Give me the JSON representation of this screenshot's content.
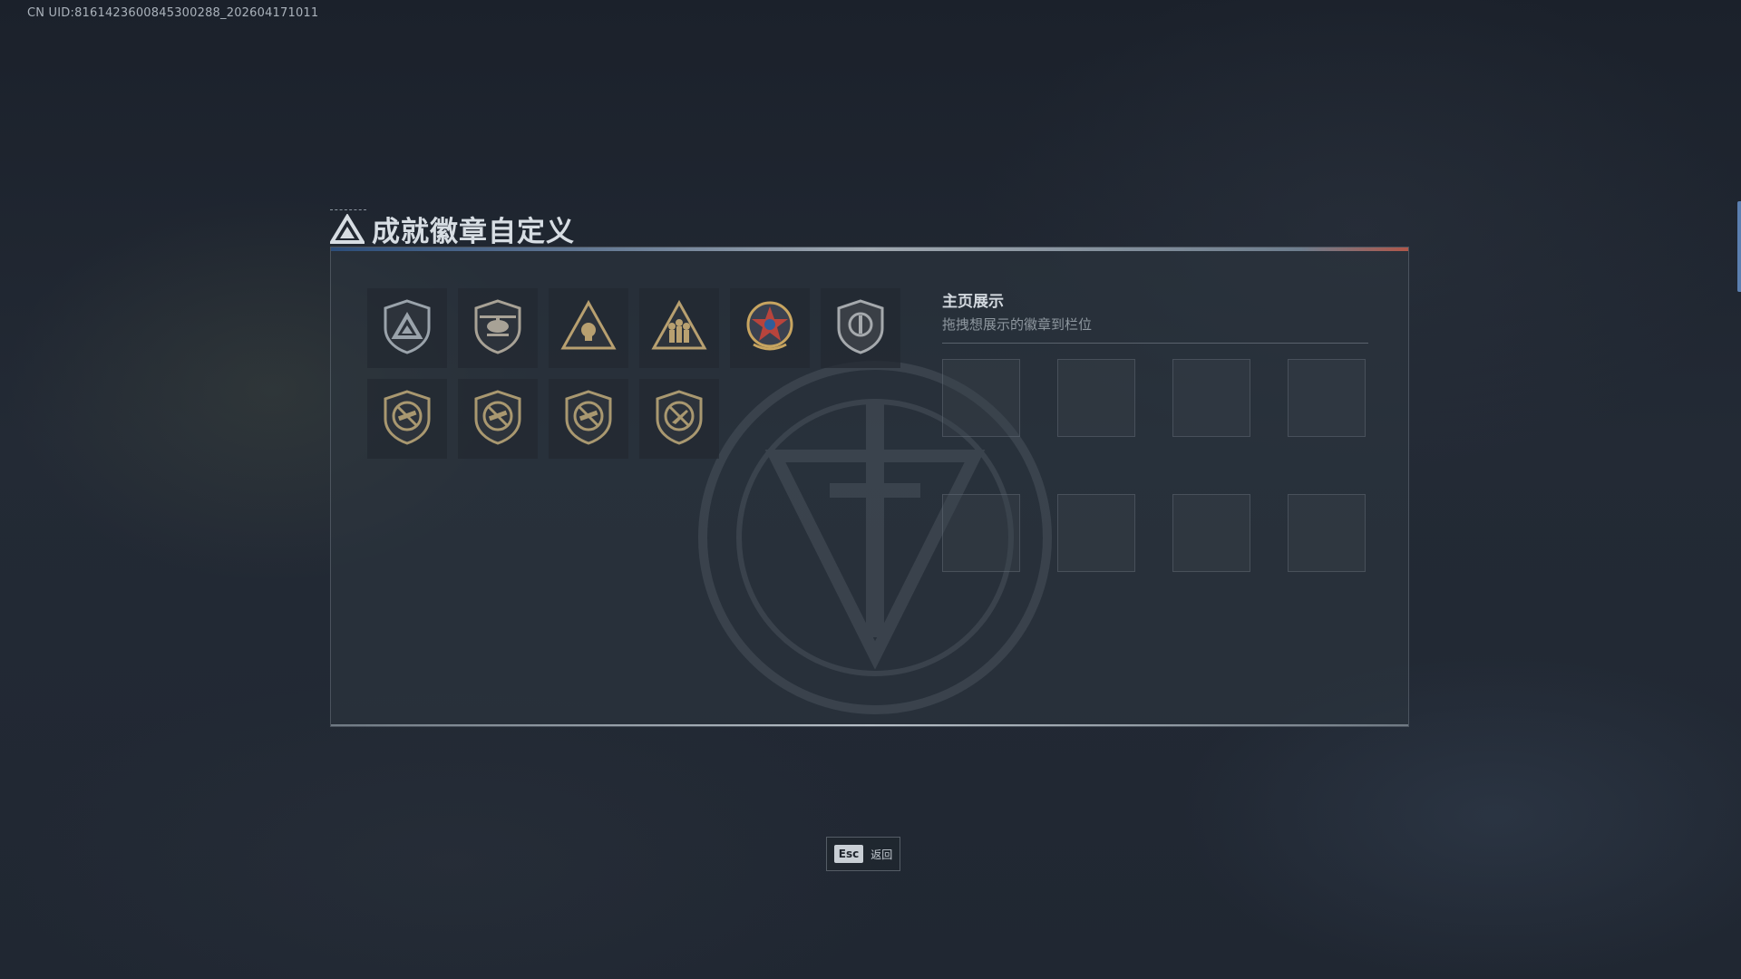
{
  "uid_text": "CN UID:8161423600845300288_202604171011",
  "page": {
    "title": "成就徽章自定义"
  },
  "badges": [
    {
      "icon": "triangle-shield-badge-icon",
      "color": "#9aa3ab"
    },
    {
      "icon": "helicopter-badge-icon",
      "color": "#a8a296"
    },
    {
      "icon": "triangle-skull-badge-icon",
      "color": "#b8a070"
    },
    {
      "icon": "triangle-soldiers-badge-icon",
      "color": "#b8a070"
    },
    {
      "icon": "star-medal-badge-icon",
      "color": "#b8443c"
    },
    {
      "icon": "round-shield-badge-icon",
      "color": "#a5a9ad"
    },
    {
      "icon": "crossed-rifle-shield-badge-icon",
      "color": "#a99870"
    },
    {
      "icon": "crossed-rifle-shield-badge-icon",
      "color": "#a99870"
    },
    {
      "icon": "crossed-rifle-shield-badge-icon",
      "color": "#a99870"
    },
    {
      "icon": "crossed-knife-shield-badge-icon",
      "color": "#a99870"
    }
  ],
  "showcase": {
    "title": "主页展示",
    "subtitle": "拖拽想展示的徽章到栏位",
    "slots": 8
  },
  "footer": {
    "esc_key": "Esc",
    "esc_label": "返回"
  }
}
